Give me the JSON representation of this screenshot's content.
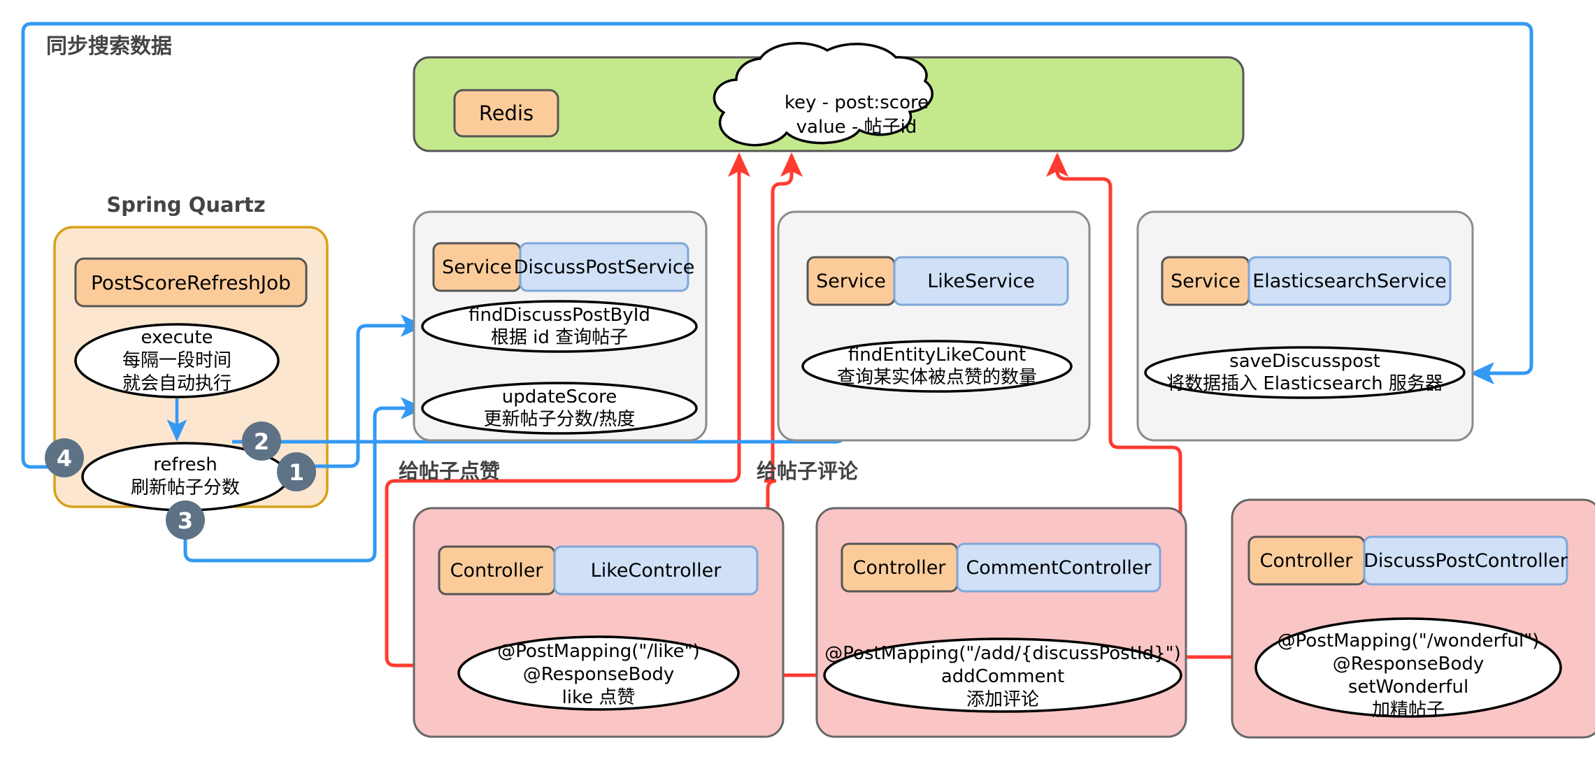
{
  "colors": {
    "blue_flow": "#3399f3",
    "red_flow": "#ff3b30",
    "green_fill": "#c4e88c",
    "green_stroke": "#555555",
    "orange_fill": "#fbcc9a",
    "orange_stroke": "#555555",
    "quartz_fill": "#fce6cf",
    "quartz_stroke": "#d6a21a",
    "blue_fill": "#cfe0f7",
    "blue_stroke": "#7ea6d9",
    "gray_fill": "#f4f4f4",
    "gray_stroke": "#8a8a8a",
    "pink_fill": "#fac5c5",
    "pink_stroke": "#666666",
    "badge_fill": "#5d7285",
    "label_text": "#444444",
    "ellipse_stroke": "#000000",
    "ellipse_fill": "#ffffff"
  },
  "groups": {
    "sync_search": {
      "label": "同步搜索数据"
    },
    "spring_quartz": {
      "label": "Spring Quartz"
    },
    "like_post": {
      "label": "给帖子点赞"
    },
    "comment_post": {
      "label": "给帖子评论"
    }
  },
  "redis_panel": {
    "box_label": "Redis",
    "cloud": {
      "line1": "key - post:score",
      "line2": "value - 帖子id"
    }
  },
  "quartz_job": {
    "class_label": "PostScoreRefreshJob",
    "methods": [
      {
        "name": "execute",
        "desc1": "每隔一段时间",
        "desc2": "就会自动执行"
      },
      {
        "name": "refresh",
        "desc1": "刷新帖子分数",
        "desc2": ""
      }
    ]
  },
  "services": [
    {
      "stereotype": "Service",
      "name": "DiscussPostService",
      "methods": [
        {
          "name": "findDiscussPostById",
          "desc": "根据 id 查询帖子"
        },
        {
          "name": "updateScore",
          "desc": "更新帖子分数/热度"
        }
      ]
    },
    {
      "stereotype": "Service",
      "name": "LikeService",
      "methods": [
        {
          "name": "findEntityLikeCount",
          "desc": "查询某实体被点赞的数量"
        }
      ]
    },
    {
      "stereotype": "Service",
      "name": "ElasticsearchService",
      "methods": [
        {
          "name": "saveDiscusspost",
          "desc": "将数据插入 Elasticsearch 服务器"
        }
      ]
    }
  ],
  "controllers": [
    {
      "stereotype": "Controller",
      "name": "LikeController",
      "lines": [
        "@PostMapping(\"/like\")",
        "@ResponseBody",
        "like 点赞"
      ]
    },
    {
      "stereotype": "Controller",
      "name": "CommentController",
      "lines": [
        "@PostMapping(\"/add/{discussPostId}\")",
        "addComment",
        "添加评论"
      ]
    },
    {
      "stereotype": "Controller",
      "name": "DiscussPostController",
      "lines": [
        "@PostMapping(\"/wonderful\")",
        "@ResponseBody",
        "setWonderful",
        "加精帖子"
      ]
    }
  ],
  "step_badges": [
    {
      "id": "badge-1",
      "label": "1"
    },
    {
      "id": "badge-2",
      "label": "2"
    },
    {
      "id": "badge-3",
      "label": "3"
    },
    {
      "id": "badge-4",
      "label": "4"
    }
  ]
}
